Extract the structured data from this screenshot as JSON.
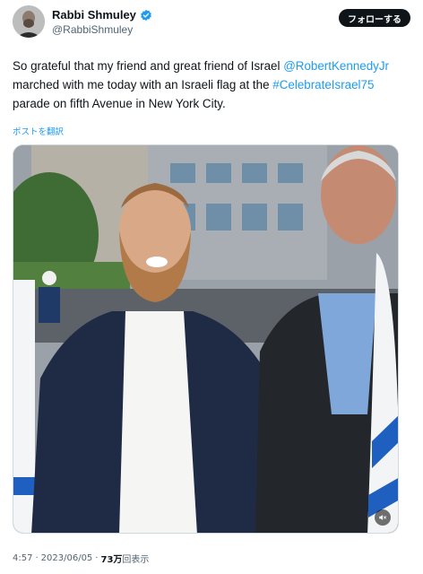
{
  "author": {
    "display_name": "Rabbi Shmuley",
    "handle": "@RabbiShmuley",
    "verified_icon": "verified-badge-icon"
  },
  "follow_button": {
    "label": "フォローする"
  },
  "tweet": {
    "segments": [
      {
        "text": "So grateful that my friend and great friend of Israel ",
        "type": "text"
      },
      {
        "text": "@RobertKennedyJr",
        "type": "mention"
      },
      {
        "text": " marched with me today with an Israeli flag at the ",
        "type": "text"
      },
      {
        "text": "#CelebrateIsrael75",
        "type": "hashtag"
      },
      {
        "text": " parade on fifth Avenue in New York City.",
        "type": "text"
      }
    ]
  },
  "translate_label": "ポストを翻訳",
  "media": {
    "mute_icon": "speaker-muted-icon"
  },
  "meta": {
    "time": "4:57",
    "dot1": "·",
    "date": "2023/06/05",
    "dot2": "·",
    "views_count": "73万",
    "views_label": "回表示"
  },
  "colors": {
    "link": "#1d9bf0",
    "text": "#0f1419",
    "secondary": "#536471"
  }
}
